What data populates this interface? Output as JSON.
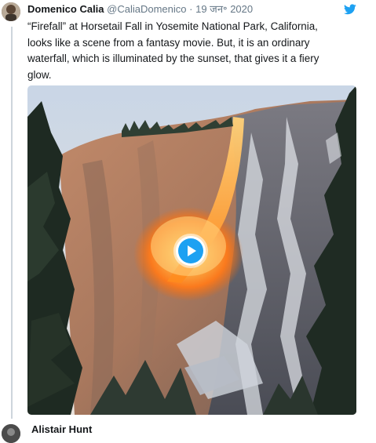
{
  "tweet": {
    "display_name": "Domenico Calia",
    "handle": "@CaliaDomenico",
    "separator": "·",
    "date": "19 जन॰ 2020",
    "text": "“Firefall” at Horsetail Fall in Yosemite National Park, California, looks like a scene from a fantasy movie. But, it is an ordinary waterfall, which is illuminated by the sunset, that gives it a fiery glow.",
    "brand_icon": "twitter-bird-icon",
    "brand_color": "#1da1f2",
    "media": {
      "type": "video",
      "play_icon": "play-icon",
      "accent_color": "#1da1f2"
    }
  },
  "next_tweet": {
    "display_name": "Alistair Hunt"
  }
}
